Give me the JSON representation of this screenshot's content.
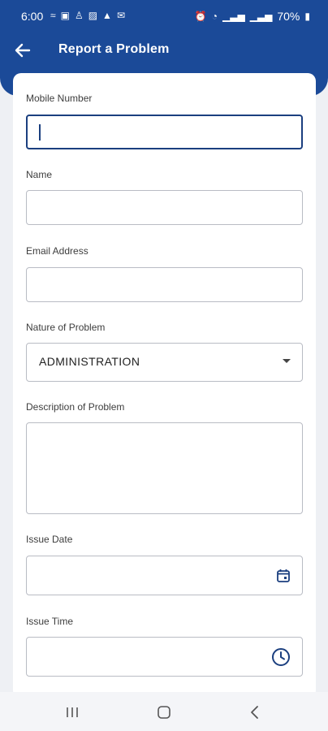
{
  "status_bar": {
    "time": "6:00",
    "battery": "70%"
  },
  "header": {
    "title": "Report a Problem"
  },
  "form": {
    "mobile_label": "Mobile Number",
    "mobile_value": "",
    "name_label": "Name",
    "name_value": "",
    "email_label": "Email Address",
    "email_value": "",
    "nature_label": "Nature of Problem",
    "nature_value": "ADMINISTRATION",
    "description_label": "Description of Problem",
    "description_value": "",
    "issue_date_label": "Issue Date",
    "issue_date_value": "",
    "issue_time_label": "Issue Time",
    "issue_time_value": ""
  },
  "icons": {
    "back": "arrow-left-icon",
    "dropdown": "caret-down-icon",
    "calendar": "calendar-icon",
    "clock": "clock-icon",
    "nav_recent": "recent-apps-icon",
    "nav_home": "home-icon",
    "nav_back": "nav-back-icon"
  },
  "colors": {
    "header": "#1b4a98",
    "accent": "#1b3f7f",
    "background": "#eef0f4"
  }
}
